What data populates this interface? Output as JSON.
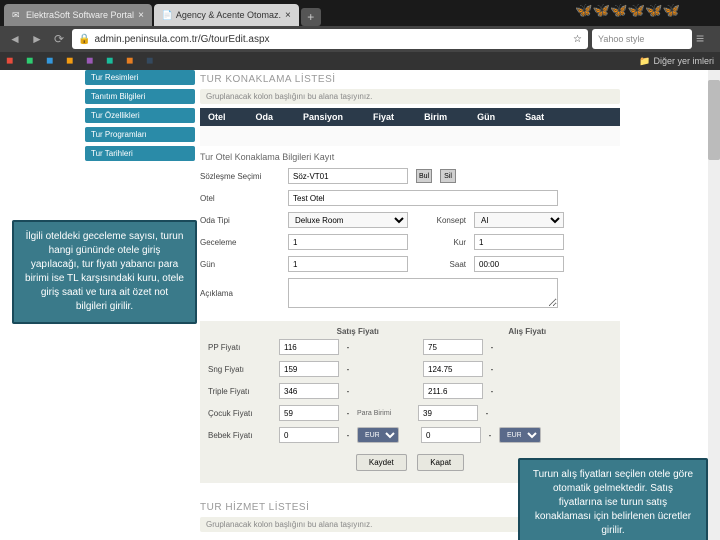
{
  "browser": {
    "tabs": [
      {
        "label": "ElektraSoft Software Portal",
        "active": false
      },
      {
        "label": "Agency & Acente Otomaz.",
        "active": true
      }
    ],
    "url": "admin.peninsula.com.tr/G/tourEdit.aspx",
    "search_placeholder": "Yahoo style",
    "bookmarks_folder": "Diğer yer imleri"
  },
  "sidebar": {
    "items": [
      "Tur Resimleri",
      "Tanıtım Bilgileri",
      "Tur Özellikleri",
      "Tur Programları",
      "Tur Tarihleri"
    ]
  },
  "section1": {
    "title": "TUR KONAKLAMA LİSTESİ",
    "hint": "Gruplanacak kolon başlığını bu alana taşıyınız.",
    "columns": [
      "Otel",
      "Oda",
      "Pansiyon",
      "Fiyat",
      "Birim",
      "Gün",
      "Saat"
    ]
  },
  "form": {
    "title": "Tur Otel Konaklama Bilgileri Kayıt",
    "rows": {
      "contract": {
        "label": "Sözleşme Seçimi",
        "value": "Söz-VT01",
        "btn1": "Bul",
        "btn2": "Sil"
      },
      "hotel": {
        "label": "Otel",
        "value": "Test Otel"
      },
      "room": {
        "label": "Oda Tipi",
        "value": "Deluxe Room",
        "concept_label": "Konsept",
        "concept_value": "AI"
      },
      "night": {
        "label": "Geceleme",
        "value": "1",
        "rate_label": "Kur",
        "rate_value": "1"
      },
      "day": {
        "label": "Gün",
        "value": "1",
        "hour_label": "Saat",
        "hour_value": "00:00"
      },
      "desc": {
        "label": "Açıklama",
        "value": ""
      }
    }
  },
  "prices": {
    "sale_header": "Satış Fiyatı",
    "buy_header": "Alış Fiyatı",
    "rows": [
      {
        "label": "PP Fiyatı",
        "sale": "116",
        "buy": "75"
      },
      {
        "label": "Sng Fiyatı",
        "sale": "159",
        "buy": "124.75"
      },
      {
        "label": "Triple Fiyatı",
        "sale": "346",
        "buy": "211.6"
      },
      {
        "label": "Çocuk Fiyatı",
        "sale": "59",
        "sale_cur": "Para Birimi",
        "buy": "39"
      },
      {
        "label": "Bebek Fiyatı",
        "sale": "0",
        "sale_cur": "EUR",
        "buy": "0",
        "buy_cur": "EUR"
      }
    ],
    "save_btn": "Kaydet",
    "close_btn": "Kapat"
  },
  "section2": {
    "title": "TUR HİZMET LİSTESİ",
    "hint": "Gruplanacak kolon başlığını bu alana taşıyınız."
  },
  "callouts": {
    "c1": "İlgili oteldeki geceleme sayısı, turun hangi gününde otele giriş yapılacağı, tur fiyatı yabancı para birimi ise TL karşısındaki kuru, otele giriş saati ve tura ait özet not bilgileri girilir.",
    "c2": "Turun alış fiyatları seçilen otele göre otomatik gelmektedir. Satış fiyatlarına ise turun satış konaklaması için belirlenen ücretler girilir."
  }
}
